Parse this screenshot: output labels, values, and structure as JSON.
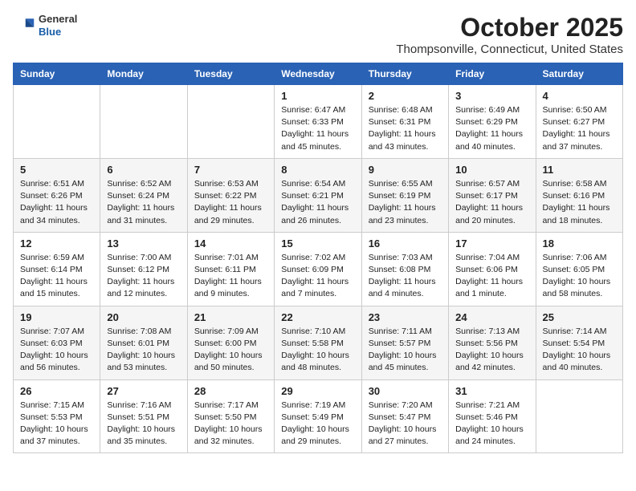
{
  "logo": {
    "general": "General",
    "blue": "Blue"
  },
  "title": "October 2025",
  "subtitle": "Thompsonville, Connecticut, United States",
  "days_of_week": [
    "Sunday",
    "Monday",
    "Tuesday",
    "Wednesday",
    "Thursday",
    "Friday",
    "Saturday"
  ],
  "weeks": [
    [
      {
        "day": "",
        "info": ""
      },
      {
        "day": "",
        "info": ""
      },
      {
        "day": "",
        "info": ""
      },
      {
        "day": "1",
        "info": "Sunrise: 6:47 AM\nSunset: 6:33 PM\nDaylight: 11 hours and 45 minutes."
      },
      {
        "day": "2",
        "info": "Sunrise: 6:48 AM\nSunset: 6:31 PM\nDaylight: 11 hours and 43 minutes."
      },
      {
        "day": "3",
        "info": "Sunrise: 6:49 AM\nSunset: 6:29 PM\nDaylight: 11 hours and 40 minutes."
      },
      {
        "day": "4",
        "info": "Sunrise: 6:50 AM\nSunset: 6:27 PM\nDaylight: 11 hours and 37 minutes."
      }
    ],
    [
      {
        "day": "5",
        "info": "Sunrise: 6:51 AM\nSunset: 6:26 PM\nDaylight: 11 hours and 34 minutes."
      },
      {
        "day": "6",
        "info": "Sunrise: 6:52 AM\nSunset: 6:24 PM\nDaylight: 11 hours and 31 minutes."
      },
      {
        "day": "7",
        "info": "Sunrise: 6:53 AM\nSunset: 6:22 PM\nDaylight: 11 hours and 29 minutes."
      },
      {
        "day": "8",
        "info": "Sunrise: 6:54 AM\nSunset: 6:21 PM\nDaylight: 11 hours and 26 minutes."
      },
      {
        "day": "9",
        "info": "Sunrise: 6:55 AM\nSunset: 6:19 PM\nDaylight: 11 hours and 23 minutes."
      },
      {
        "day": "10",
        "info": "Sunrise: 6:57 AM\nSunset: 6:17 PM\nDaylight: 11 hours and 20 minutes."
      },
      {
        "day": "11",
        "info": "Sunrise: 6:58 AM\nSunset: 6:16 PM\nDaylight: 11 hours and 18 minutes."
      }
    ],
    [
      {
        "day": "12",
        "info": "Sunrise: 6:59 AM\nSunset: 6:14 PM\nDaylight: 11 hours and 15 minutes."
      },
      {
        "day": "13",
        "info": "Sunrise: 7:00 AM\nSunset: 6:12 PM\nDaylight: 11 hours and 12 minutes."
      },
      {
        "day": "14",
        "info": "Sunrise: 7:01 AM\nSunset: 6:11 PM\nDaylight: 11 hours and 9 minutes."
      },
      {
        "day": "15",
        "info": "Sunrise: 7:02 AM\nSunset: 6:09 PM\nDaylight: 11 hours and 7 minutes."
      },
      {
        "day": "16",
        "info": "Sunrise: 7:03 AM\nSunset: 6:08 PM\nDaylight: 11 hours and 4 minutes."
      },
      {
        "day": "17",
        "info": "Sunrise: 7:04 AM\nSunset: 6:06 PM\nDaylight: 11 hours and 1 minute."
      },
      {
        "day": "18",
        "info": "Sunrise: 7:06 AM\nSunset: 6:05 PM\nDaylight: 10 hours and 58 minutes."
      }
    ],
    [
      {
        "day": "19",
        "info": "Sunrise: 7:07 AM\nSunset: 6:03 PM\nDaylight: 10 hours and 56 minutes."
      },
      {
        "day": "20",
        "info": "Sunrise: 7:08 AM\nSunset: 6:01 PM\nDaylight: 10 hours and 53 minutes."
      },
      {
        "day": "21",
        "info": "Sunrise: 7:09 AM\nSunset: 6:00 PM\nDaylight: 10 hours and 50 minutes."
      },
      {
        "day": "22",
        "info": "Sunrise: 7:10 AM\nSunset: 5:58 PM\nDaylight: 10 hours and 48 minutes."
      },
      {
        "day": "23",
        "info": "Sunrise: 7:11 AM\nSunset: 5:57 PM\nDaylight: 10 hours and 45 minutes."
      },
      {
        "day": "24",
        "info": "Sunrise: 7:13 AM\nSunset: 5:56 PM\nDaylight: 10 hours and 42 minutes."
      },
      {
        "day": "25",
        "info": "Sunrise: 7:14 AM\nSunset: 5:54 PM\nDaylight: 10 hours and 40 minutes."
      }
    ],
    [
      {
        "day": "26",
        "info": "Sunrise: 7:15 AM\nSunset: 5:53 PM\nDaylight: 10 hours and 37 minutes."
      },
      {
        "day": "27",
        "info": "Sunrise: 7:16 AM\nSunset: 5:51 PM\nDaylight: 10 hours and 35 minutes."
      },
      {
        "day": "28",
        "info": "Sunrise: 7:17 AM\nSunset: 5:50 PM\nDaylight: 10 hours and 32 minutes."
      },
      {
        "day": "29",
        "info": "Sunrise: 7:19 AM\nSunset: 5:49 PM\nDaylight: 10 hours and 29 minutes."
      },
      {
        "day": "30",
        "info": "Sunrise: 7:20 AM\nSunset: 5:47 PM\nDaylight: 10 hours and 27 minutes."
      },
      {
        "day": "31",
        "info": "Sunrise: 7:21 AM\nSunset: 5:46 PM\nDaylight: 10 hours and 24 minutes."
      },
      {
        "day": "",
        "info": ""
      }
    ]
  ]
}
